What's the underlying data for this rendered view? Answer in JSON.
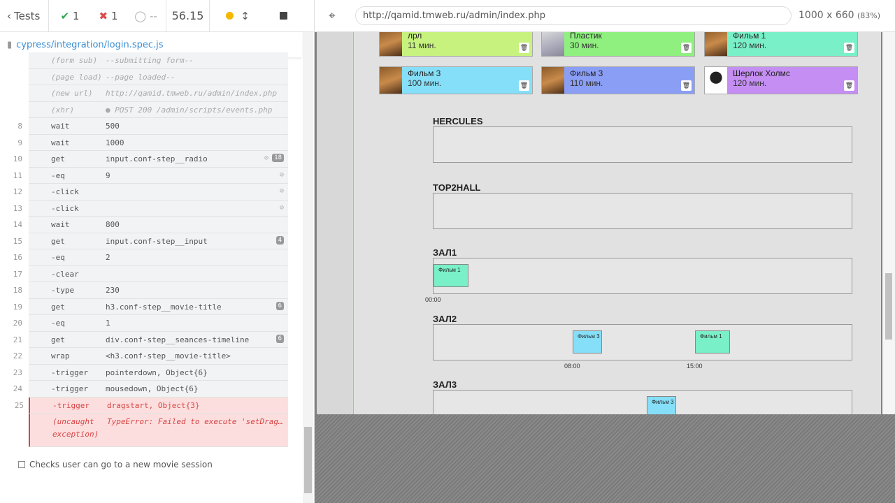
{
  "header": {
    "back_label": "Tests",
    "passed": "1",
    "failed": "1",
    "pending": "--",
    "duration": "56.15"
  },
  "spec": {
    "path": "cypress/integration/login.spec.js"
  },
  "log": [
    {
      "num": "",
      "cmd": "(form sub)",
      "arg": "--submitting form--",
      "kind": "sub"
    },
    {
      "num": "",
      "cmd": "(page load)",
      "arg": "--page loaded--",
      "kind": "sub"
    },
    {
      "num": "",
      "cmd": "(new url)",
      "arg": "http://qamid.tmweb.ru/admin/index.php",
      "kind": "sub"
    },
    {
      "num": "",
      "cmd": "(xhr)",
      "arg": "● POST 200 /admin/scripts/events.php",
      "kind": "sub"
    },
    {
      "num": "8",
      "cmd": "wait",
      "arg": "500",
      "kind": ""
    },
    {
      "num": "9",
      "cmd": "wait",
      "arg": "1000",
      "kind": ""
    },
    {
      "num": "10",
      "cmd": "get",
      "arg": "input.conf-step__radio",
      "kind": "",
      "badge": "18",
      "eye": true
    },
    {
      "num": "11",
      "cmd": "-eq",
      "arg": "9",
      "kind": "",
      "eye": true
    },
    {
      "num": "12",
      "cmd": "-click",
      "arg": "",
      "kind": "",
      "eye": true
    },
    {
      "num": "13",
      "cmd": "-click",
      "arg": "",
      "kind": "",
      "eye": true
    },
    {
      "num": "14",
      "cmd": "wait",
      "arg": "800",
      "kind": ""
    },
    {
      "num": "15",
      "cmd": "get",
      "arg": "input.conf-step__input",
      "kind": "",
      "badge": "4"
    },
    {
      "num": "16",
      "cmd": "-eq",
      "arg": "2",
      "kind": ""
    },
    {
      "num": "17",
      "cmd": "-clear",
      "arg": "",
      "kind": ""
    },
    {
      "num": "18",
      "cmd": "-type",
      "arg": "230",
      "kind": ""
    },
    {
      "num": "19",
      "cmd": "get",
      "arg": "h3.conf-step__movie-title",
      "kind": "",
      "badge": "6"
    },
    {
      "num": "20",
      "cmd": "-eq",
      "arg": "1",
      "kind": ""
    },
    {
      "num": "21",
      "cmd": "get",
      "arg": "div.conf-step__seances-timeline",
      "kind": "",
      "badge": "6"
    },
    {
      "num": "22",
      "cmd": "wrap",
      "arg": "<h3.conf-step__movie-title>",
      "kind": ""
    },
    {
      "num": "23",
      "cmd": "-trigger",
      "arg": "pointerdown, Object{6}",
      "kind": ""
    },
    {
      "num": "24",
      "cmd": "-trigger",
      "arg": "mousedown, Object{6}",
      "kind": ""
    },
    {
      "num": "25",
      "cmd": "-trigger",
      "arg": "dragstart, Object{3}",
      "kind": "err"
    },
    {
      "num": "",
      "cmd": "(uncaught",
      "cmd2": "exception)",
      "arg": "TypeError: Failed to execute 'setDrag…",
      "kind": "err2"
    }
  ],
  "test_title": "Checks user can go to a new movie session",
  "browser": {
    "url": "http://qamid.tmweb.ru/admin/index.php",
    "viewport": "1000 x 660",
    "zoom": "(83%)"
  },
  "movies": [
    {
      "title": "лрл",
      "duration": "11 мин.",
      "color": "#c6f27d"
    },
    {
      "title": "Пластик",
      "duration": "30 мин.",
      "color": "#8ff07f"
    },
    {
      "title": "Фильм 1",
      "duration": "120 мин.",
      "color": "#79f0c7"
    },
    {
      "title": "Фильм 3",
      "duration": "100 мин.",
      "color": "#85dff8"
    },
    {
      "title": "Фильм 3",
      "duration": "110 мин.",
      "color": "#8a9ef5"
    },
    {
      "title": "Шерлок Холмс",
      "duration": "120 мин.",
      "color": "#c48ef3"
    }
  ],
  "halls": [
    {
      "name": "HERCULES"
    },
    {
      "name": "TOP2HALL"
    },
    {
      "name": "ЗАЛ1",
      "seances": [
        {
          "title": "Фильм 1",
          "time": "00:00",
          "color": "#79f0c7"
        }
      ]
    },
    {
      "name": "ЗАЛ2",
      "seances": [
        {
          "title": "Фильм 3",
          "time": "08:00",
          "color": "#85dff8"
        },
        {
          "title": "Фильм 1",
          "time": "15:00",
          "color": "#79f0c7"
        }
      ]
    },
    {
      "name": "ЗАЛ3",
      "seances": [
        {
          "title": "Фильм 3",
          "color": "#85dff8"
        }
      ]
    }
  ]
}
